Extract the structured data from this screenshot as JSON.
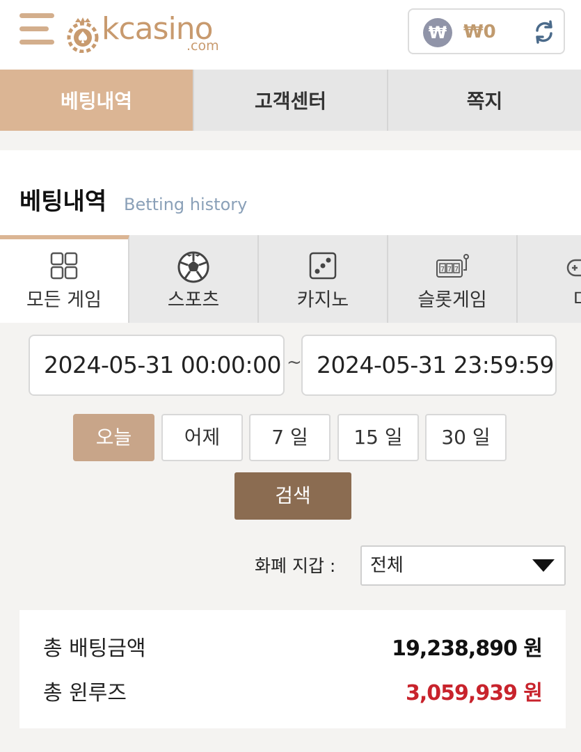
{
  "header": {
    "logo_text": "kcasino",
    "logo_domain": ".com",
    "balance": "₩0",
    "currency_symbol": "₩"
  },
  "topnav": [
    {
      "label": "베팅내역",
      "active": true
    },
    {
      "label": "고객센터",
      "active": false
    },
    {
      "label": "쪽지",
      "active": false
    }
  ],
  "page": {
    "title": "베팅내역",
    "subtitle": "Betting history"
  },
  "game_tabs": [
    {
      "label": "모든 게임",
      "icon": "grid-icon",
      "active": true
    },
    {
      "label": "스포츠",
      "icon": "soccer-ball-icon",
      "active": false
    },
    {
      "label": "카지노",
      "icon": "dice-icon",
      "active": false
    },
    {
      "label": "슬롯게임",
      "icon": "slot-machine-icon",
      "active": false
    },
    {
      "label": "미",
      "icon": "gamepad-icon",
      "active": false
    }
  ],
  "filters": {
    "start_date": "2024-05-31 00:00:00",
    "end_date": "2024-05-31 23:59:59",
    "separator": "~",
    "periods": [
      {
        "label": "오늘",
        "active": true
      },
      {
        "label": "어제",
        "active": false
      },
      {
        "label": "7 일",
        "active": false
      },
      {
        "label": "15 일",
        "active": false
      },
      {
        "label": "30 일",
        "active": false
      }
    ],
    "search_label": "검색",
    "currency_label": "화폐 지갑 :",
    "currency_value": "전체"
  },
  "summary": {
    "total_bet_label": "총 배팅금액",
    "total_bet_value": "19,238,890 원",
    "total_winloss_label": "총 윈루즈",
    "total_winloss_value": "3,059,939 원"
  },
  "colors": {
    "accent": "#dbb594",
    "search_button": "#8b6c51",
    "loss_red": "#c8232c"
  }
}
